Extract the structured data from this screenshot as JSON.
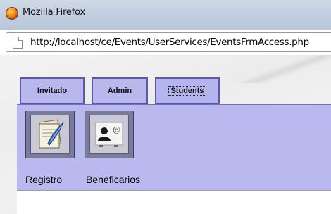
{
  "window": {
    "title": "Mozilla Firefox"
  },
  "address_bar": {
    "url": "http://localhost/ce/Events/UserServices/EventsFrmAccess.php"
  },
  "tabs": [
    {
      "label": "Invitado"
    },
    {
      "label": "Admin"
    },
    {
      "label": "Students"
    }
  ],
  "panel": {
    "items": [
      {
        "label": "Registro",
        "icon": "registro-icon"
      },
      {
        "label": "Beneficarios",
        "icon": "beneficiarios-icon"
      }
    ]
  },
  "colors": {
    "tab_fill": "#b8b8ec",
    "tab_border": "#5a5aa6",
    "panel_fill": "#b9b9f0"
  }
}
